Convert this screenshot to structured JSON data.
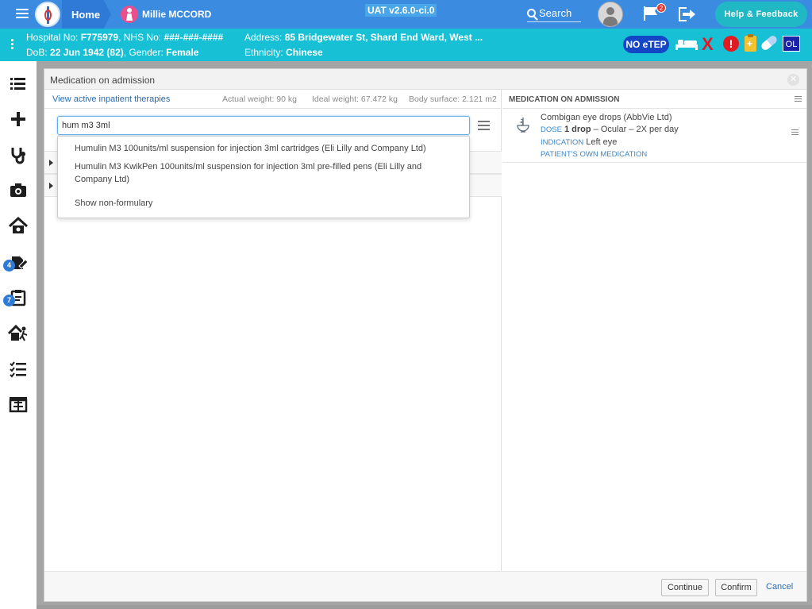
{
  "topbar": {
    "home_label": "Home",
    "patient_name": "Millie MCCORD",
    "version": "UAT v2.6.0-ci.0",
    "search_label": "Search",
    "flag_count": "2",
    "help_label": "Help & Feedback",
    "accent_color": "#3b8be0"
  },
  "banner": {
    "hospital_no_label": "Hospital No:",
    "hospital_no": "F775979",
    "nhs_label": ", NHS No:",
    "nhs_no": "###-###-####",
    "address_label": "Address:",
    "address": "85 Bridgewater St, Shard End Ward, West ...",
    "dob_label": "DoB:",
    "dob": "22 Jun 1942 (82)",
    "gender_label": ", Gender:",
    "gender": "Female",
    "ethnicity_label": "Ethnicity:",
    "ethnicity": "Chinese",
    "no_etep": "NO eTEP",
    "alert_glyph": "!",
    "x_glyph": "X",
    "ol_badge": "OL",
    "color": "#18c0d6"
  },
  "sidebar": {
    "items": [
      {
        "icon": "list-icon"
      },
      {
        "icon": "plus-icon"
      },
      {
        "icon": "stethoscope-icon"
      },
      {
        "icon": "camera-icon"
      },
      {
        "icon": "home-heart-icon"
      },
      {
        "icon": "prescription-edit-icon",
        "badge": "4"
      },
      {
        "icon": "clipboard-edit-icon",
        "badge": "7"
      },
      {
        "icon": "discharge-icon"
      },
      {
        "icon": "checklist-icon"
      },
      {
        "icon": "hospital-building-icon"
      }
    ]
  },
  "modal": {
    "title": "Medication on admission",
    "close_glyph": "✕",
    "left": {
      "view_link": "View active inpatient therapies",
      "actual_weight": "Actual weight: 90 kg",
      "ideal_weight": "Ideal weight: 67.472 kg",
      "body_surface": "Body surface: 2.121 m2",
      "search_value": "hum m3 3ml",
      "dropdown": {
        "items": [
          "Humulin M3 100units/ml suspension for injection 3ml cartridges (Eli Lilly and Company Ltd)",
          "Humulin M3 KwikPen 100units/ml suspension for injection 3ml pre-filled pens (Eli Lilly and Company Ltd)"
        ],
        "show_non_formulary": "Show non-formulary"
      }
    },
    "right": {
      "header": "MEDICATION ON ADMISSION",
      "med": {
        "name": "Combigan eye drops (AbbVie Ltd)",
        "dose_tag": "DOSE",
        "dose_value": "1 drop",
        "dose_rest": " – Ocular – 2X per day",
        "indication_tag": "INDICATION",
        "indication_value": "Left eye",
        "source_tag": "PATIENT'S OWN MEDICATION"
      }
    },
    "footer": {
      "continue": "Continue",
      "confirm": "Confirm",
      "cancel": "Cancel"
    }
  }
}
